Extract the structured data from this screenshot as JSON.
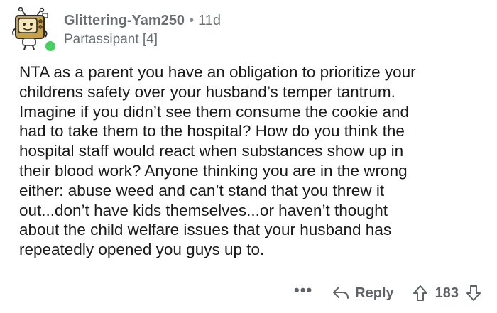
{
  "comment": {
    "author": {
      "username": "Glittering-Yam250",
      "separator": "•",
      "age": "11d",
      "flair": "Partassipant [4]",
      "avatar_icon": "snoo-tv-avatar-icon",
      "online_color": "#46d160"
    },
    "body_lines": [
      "NTA as a parent you have an obligation to prioritize your",
      "childrens safety over your husband’s temper tantrum.",
      "Imagine if you didn’t see them consume the cookie and",
      "had to take them to the hospital? How do you think the",
      "hospital staff would react when substances show up in",
      "their blood work? Anyone thinking you are in the wrong",
      "either: abuse weed and can’t stand that you threw it",
      "out...don’t have kids themselves...or haven’t thought",
      "about  the child welfare issues that your husband has",
      "repeatedly opened you guys up to."
    ],
    "actions": {
      "more_label": "•••",
      "reply_label": "Reply",
      "reply_icon": "reply-arrow-icon",
      "upvote_icon": "upvote-arrow-icon",
      "score": "183",
      "downvote_icon": "downvote-arrow-icon"
    }
  }
}
